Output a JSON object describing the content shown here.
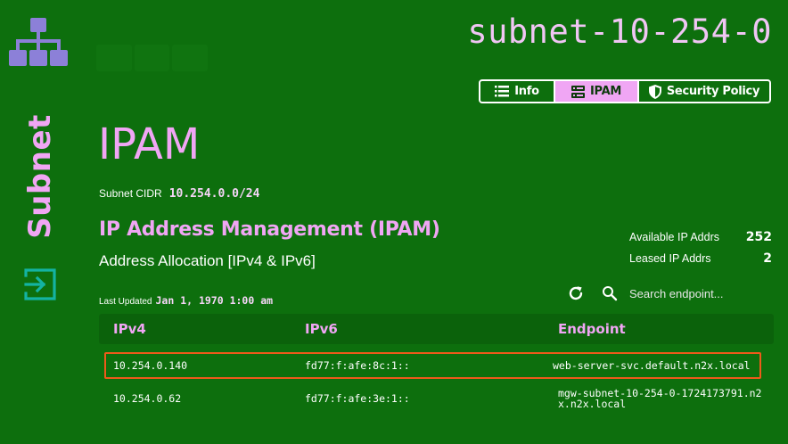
{
  "sidebar": {
    "title": "Subnet"
  },
  "header": {
    "subnet_name": "subnet-10-254-0"
  },
  "tabs": [
    {
      "label": "Info",
      "icon": "list-icon",
      "active": false
    },
    {
      "label": "IPAM",
      "icon": "server-icon",
      "active": true
    },
    {
      "label": "Security Policy",
      "icon": "shield-icon",
      "active": false
    }
  ],
  "page": {
    "heading": "IPAM",
    "cidr_label": "Subnet CIDR",
    "cidr_value": "10.254.0.0/24",
    "section_title": "IP Address Management (IPAM)",
    "section_subtitle": "Address Allocation [IPv4 & IPv6]",
    "updated_label": "Last Updated",
    "updated_value": "Jan 1, 1970 1:00 am"
  },
  "stats": [
    {
      "label": "Available IP Addrs",
      "value": "252"
    },
    {
      "label": "Leased IP Addrs",
      "value": "2"
    }
  ],
  "search": {
    "placeholder": "Search endpoint..."
  },
  "table": {
    "headers": [
      "IPv4",
      "IPv6",
      "Endpoint"
    ],
    "rows": [
      {
        "ipv4": "10.254.0.140",
        "ipv6": "fd77:f:afe:8c:1::",
        "endpoint": "web-server-svc.default.n2x.local"
      },
      {
        "ipv4": "10.254.0.62",
        "ipv6": "fd77:f:afe:3e:1::",
        "endpoint": "mgw-subnet-10-254-0-1724173791.n2x.n2x.local"
      }
    ]
  },
  "colors": {
    "background": "#0d6f0d",
    "accent": "#f0a6f4",
    "logo": "#8c80d8",
    "exit_icon": "#14b3a3",
    "highlight": "#ee5a1a"
  }
}
